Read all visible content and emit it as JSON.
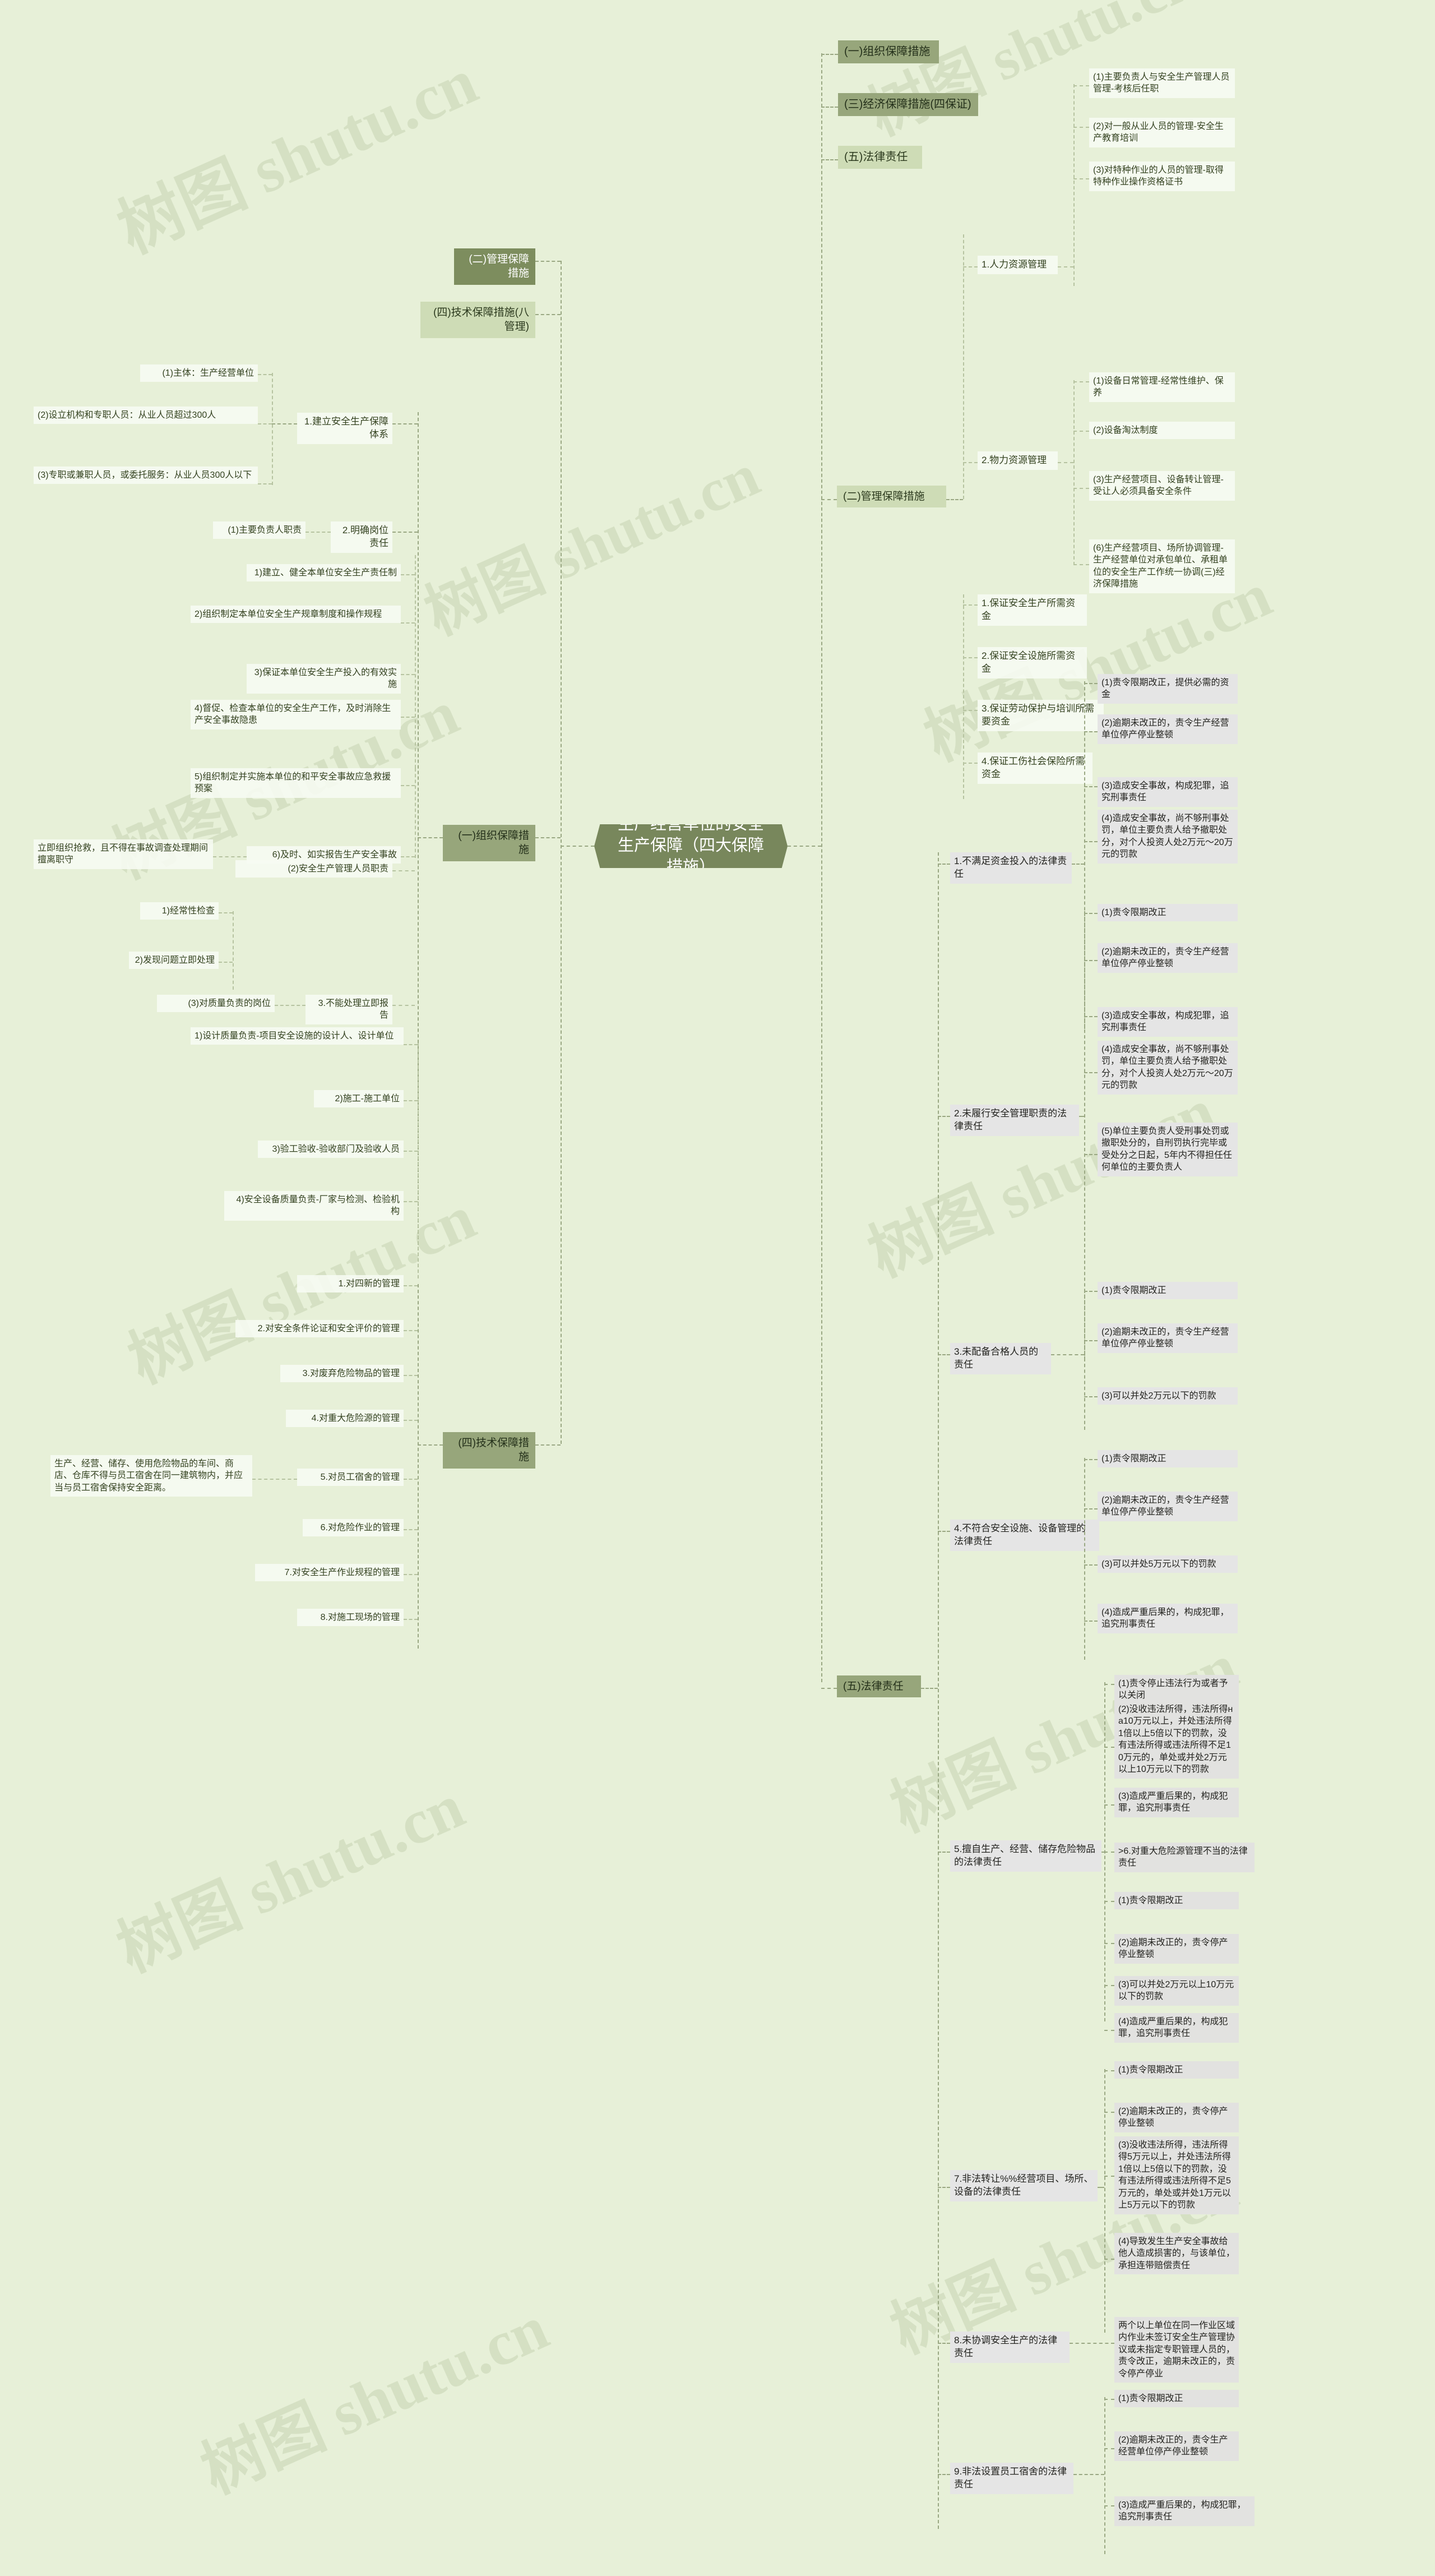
{
  "meta": {
    "watermark_text_cn": "树图",
    "watermark_text_en": "shutu.cn",
    "accent_dark": "#78875c",
    "accent_mid": "#97a67b",
    "accent_light": "#cedcb6",
    "background": "#e7f0d8",
    "node_bg": "#f7faf2",
    "node_bg_grey": "#e5e5e5"
  },
  "root": {
    "title": "生产经营单位的安全生产保障（四大保障措施）"
  },
  "branches": {
    "org": {
      "label": "(一)组织保障措施"
    },
    "mgmt": {
      "label": "(二)管理保障措施"
    },
    "econ": {
      "label": "(三)经济保障措施(四保证)"
    },
    "tech": {
      "label": "(四)技术保障措施(八管理)"
    },
    "legal": {
      "label": "(五)法律责任"
    }
  },
  "left": {
    "org_label": "(一)组织保障措施",
    "tech_label": "(四)技术保障措施",
    "mgmt_top_label": "(二)管理保障措施",
    "tech_top_label": "(四)技术保障措施(八管理)",
    "system": {
      "label": "1.建立安全生产保障体系",
      "items": [
        "(1)主体：生产经营单位",
        "(2)设立机构和专职人员：从业人员超过300人",
        "(3)专职或兼职人员，或委托服务：从业人员300人以下"
      ]
    },
    "posts": {
      "label": "2.明确岗位责任",
      "principal": {
        "label": "(1)主要负责人职责",
        "items": [
          "1)建立、健全本单位安全生产责任制",
          "2)组织制定本单位安全生产规章制度和操作规程",
          "3)保证本单位安全生产投入的有效实施",
          "4)督促、检查本单位的安全生产工作，及时消除生产安全事故隐患",
          "5)组织制定并实施本单位的和平安全事故应急救援预案",
          "6)及时、如实报告生产安全事故"
        ],
        "note": "立即组织抢救，且不得在事故调查处理期间擅离职守"
      },
      "safety_mgr": {
        "label": "(2)安全生产管理人员职责",
        "items": [
          "1)经常性检查",
          "2)发现问题立即处理"
        ]
      },
      "report": {
        "label": "3.不能处理立即报告",
        "label_sub": "(3)对质量负责的岗位",
        "items": [
          "1)设计质量负责-项目安全设施的设计人、设计单位",
          "2)施工-施工单位",
          "3)验工验收-验收部门及验收人员",
          "4)安全设备质量负责-厂家与检测、检验机构"
        ]
      }
    },
    "tech_items": [
      "1.对四新的管理",
      "2.对安全条件论证和安全评价的管理",
      "3.对废弃危险物品的管理",
      "4.对重大危险源的管理",
      "5.对员工宿舍的管理",
      "6.对危险作业的管理",
      "7.对安全生产作业规程的管理",
      "8.对施工现场的管理"
    ],
    "dorm_note": "生产、经营、储存、使用危险物品的车间、商店、仓库不得与员工宿舍在同一建筑物内，并应当与员工宿舍保持安全距离。"
  },
  "right": {
    "mgmt": {
      "label": "(二)管理保障措施",
      "groups": [
        {
          "label": "1.人力资源管理",
          "items": [
            "(1)主要负责人与安全生产管理人员管理-考核后任职",
            "(2)对一般从业人员的管理-安全生产教育培训",
            "(3)对特种作业的人员的管理-取得特种作业操作资格证书"
          ]
        },
        {
          "label": "2.物力资源管理",
          "items": [
            "(1)设备日常管理-经常性维护、保养",
            "(2)设备淘汰制度",
            "(3)生产经营项目、设备转让管理-受让人必须具备安全条件",
            "(6)生产经营项目、场所协调管理-生产经营单位对承包单位、承租单位的安全生产工作统一协调(三)经济保障措施"
          ]
        }
      ]
    },
    "econ_items": [
      "1.保证安全生产所需资金",
      "2.保证安全设施所需资金",
      "3.保证劳动保护与培训所需要资金",
      "4.保证工伤社会保险所需资金"
    ],
    "legal": {
      "label": "(五)法律责任",
      "groups": [
        {
          "label": "1.不满足资金投入的法律责任",
          "items": [
            "(1)责令限期改正，提供必需的资金",
            "(2)逾期未改正的，责令生产经营单位停产停业整顿",
            "(3)造成安全事故，构成犯罪，追究刑事责任",
            "(4)造成安全事故，尚不够刑事处罚，单位主要负责人给予撤职处分，对个人投资人处2万元～20万元的罚款"
          ]
        },
        {
          "label": "2.未履行安全管理职责的法律责任",
          "items": [
            "(1)责令限期改正",
            "(2)逾期未改正的，责令生产经营单位停产停业整顿",
            "(3)造成安全事故，构成犯罪，追究刑事责任",
            "(4)造成安全事故，尚不够刑事处罚，单位主要负责人给予撤职处分，对个人投资人处2万元～20万元的罚款",
            "(5)单位主要负责人受刑事处罚或撤职处分的，自刑罚执行完毕或受处分之日起，5年内不得担任任何单位的主要负责人"
          ]
        },
        {
          "label": "3.未配备合格人员的责任",
          "items": [
            "(1)责令限期改正",
            "(2)逾期未改正的，责令生产经营单位停产停业整顿",
            "(3)可以并处2万元以下的罚款"
          ]
        },
        {
          "label": "4.不符合安全设施、设备管理的法律责任",
          "items": [
            "(1)责令限期改正",
            "(2)逾期未改正的，责令生产经营单位停产停业整顿",
            "(3)可以并处5万元以下的罚款",
            "(4)造成严重后果的，构成犯罪，追究刑事责任"
          ]
        },
        {
          "label": "5.擅自生产、经营、储存危险物品的法律责任",
          "items": [
            "(1)责令停止违法行为或者予以关闭",
            "(2)没收违法所得，违法所得на10万元以上，并处违法所得1倍以上5倍以下的罚款，没有违法所得或违法所得不足10万元的，单处或并处2万元以上10万元以下的罚款",
            "(3)造成严重后果的，构成犯罪，追究刑事责任"
          ]
        },
        {
          "label": ">6.对重大危险源管理不当的法律责任",
          "items": [
            "(1)责令限期改正",
            "(2)逾期未改正的，责令停产停业整顿",
            "(3)可以并处2万元以上10万元以下的罚款",
            "(4)造成严重后果的，构成犯罪，追究刑事责任"
          ]
        },
        {
          "label": "7.非法转让%%经营项目、场所、设备的法律责任",
          "items": [
            "(1)责令限期改正",
            "(2)逾期未改正的，责令停产停业整顿",
            "(3)没收违法所得，违法所得得5万元以上，并处违法所得1倍以上5倍以下的罚款，没有违法所得或违法所得不足5万元的，单处或并处1万元以上5万元以下的罚款",
            "(4)导致发生生产安全事故给他人造成损害的，与该单位，承担连带赔偿责任"
          ]
        },
        {
          "label": "8.未协调安全生产的法律责任",
          "items": [
            "两个以上单位在同一作业区域内作业未签订安全生产管理协议或未指定专职管理人员的，责令改正，逾期未改正的，责令停产停业"
          ]
        },
        {
          "label": "9.非法设置员工宿舍的法律责任",
          "items": [
            "(1)责令限期改正",
            "(2)逾期未改正的，责令生产经营单位停产停业整顿",
            "(3)造成严重后果的，构成犯罪，追究刑事责任"
          ]
        }
      ]
    }
  }
}
